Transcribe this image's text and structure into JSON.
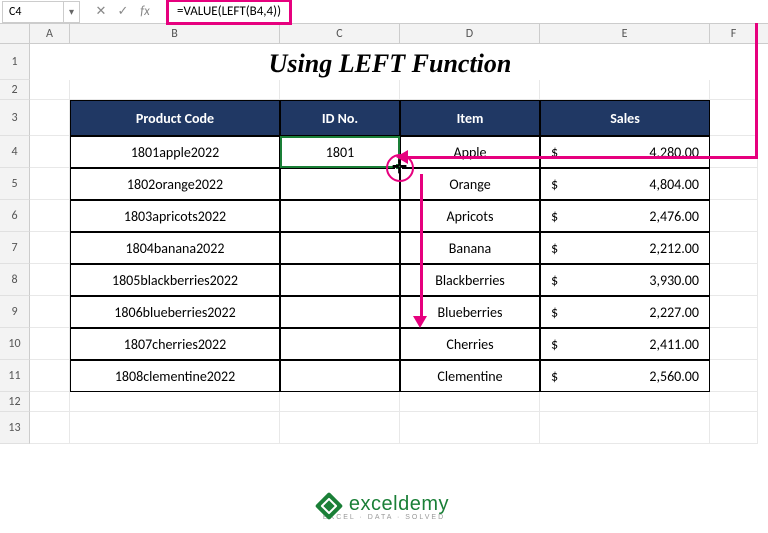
{
  "formula_bar": {
    "name_box": "C4",
    "fx_label": "fx",
    "formula": "=VALUE(LEFT(B4,4))"
  },
  "columns": [
    "A",
    "B",
    "C",
    "D",
    "E",
    "F"
  ],
  "row_numbers": [
    "1",
    "2",
    "3",
    "4",
    "5",
    "6",
    "7",
    "8",
    "9",
    "10",
    "11",
    "12",
    "13"
  ],
  "title": "Using LEFT Function",
  "headers": {
    "b": "Product Code",
    "c": "ID No.",
    "d": "Item",
    "e": "Sales"
  },
  "rows": [
    {
      "code": "1801apple2022",
      "id": "1801",
      "item": "Apple",
      "cur": "$",
      "sales": "4,280.00"
    },
    {
      "code": "1802orange2022",
      "id": "",
      "item": "Orange",
      "cur": "$",
      "sales": "4,804.00"
    },
    {
      "code": "1803apricots2022",
      "id": "",
      "item": "Apricots",
      "cur": "$",
      "sales": "2,476.00"
    },
    {
      "code": "1804banana2022",
      "id": "",
      "item": "Banana",
      "cur": "$",
      "sales": "2,212.00"
    },
    {
      "code": "1805blackberries2022",
      "id": "",
      "item": "Blackberries",
      "cur": "$",
      "sales": "3,930.00"
    },
    {
      "code": "1806blueberries2022",
      "id": "",
      "item": "Blueberries",
      "cur": "$",
      "sales": "2,227.00"
    },
    {
      "code": "1807cherries2022",
      "id": "",
      "item": "Cherries",
      "cur": "$",
      "sales": "2,411.00"
    },
    {
      "code": "1808clementine2022",
      "id": "",
      "item": "Clementine",
      "cur": "$",
      "sales": "2,560.00"
    }
  ],
  "logo": {
    "brand": "exceldemy",
    "tag": "EXCEL · DATA · SOLVED"
  }
}
